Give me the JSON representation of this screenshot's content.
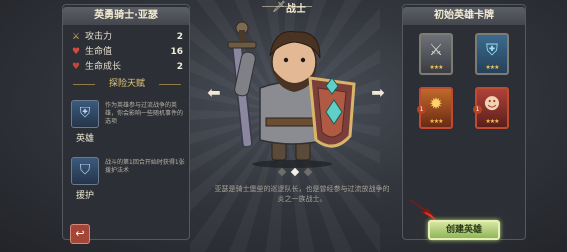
{
  "hero": {
    "name": "英勇骑士·亚瑟",
    "stats": [
      {
        "icon": "sword-icon",
        "label": "攻击力",
        "value": "2"
      },
      {
        "icon": "heart-icon",
        "label": "生命值",
        "value": "16"
      },
      {
        "icon": "heart-plus-icon",
        "label": "生命成长",
        "value": "2"
      }
    ],
    "talent_section": "探险天赋",
    "talents": [
      {
        "icon": "shield-hero-icon",
        "name": "英雄",
        "desc": "作为英雄参与过流战争的英雄，你会影响一些随机事件的选项"
      },
      {
        "icon": "armor-icon",
        "name": "援护",
        "desc": "战斗的第1回合开始时获得1张援护法术"
      }
    ]
  },
  "class": {
    "icon": "sword-class-icon",
    "label": "战士"
  },
  "story": "亚瑟是骑士堡垒的巡逻队长，也是曾经参与过流放战争的炎之一族战士。",
  "carousel": {
    "count": 3,
    "active": 1
  },
  "cards_panel": {
    "title": "初始英雄卡牌",
    "cards": [
      {
        "icon": "sword-card-icon",
        "stars": "★★★",
        "cost": ""
      },
      {
        "icon": "shield-card-icon",
        "stars": "★★★",
        "cost": ""
      },
      {
        "icon": "fire-card-icon",
        "stars": "★★★",
        "cost": "1"
      },
      {
        "icon": "girl-card-icon",
        "stars": "★★★",
        "cost": "1"
      }
    ]
  },
  "buttons": {
    "create": "创建英雄",
    "back": "↩"
  },
  "colors": {
    "accent": "#e7c77a",
    "create_btn": "#b9d57e",
    "back_btn": "#a24638"
  }
}
